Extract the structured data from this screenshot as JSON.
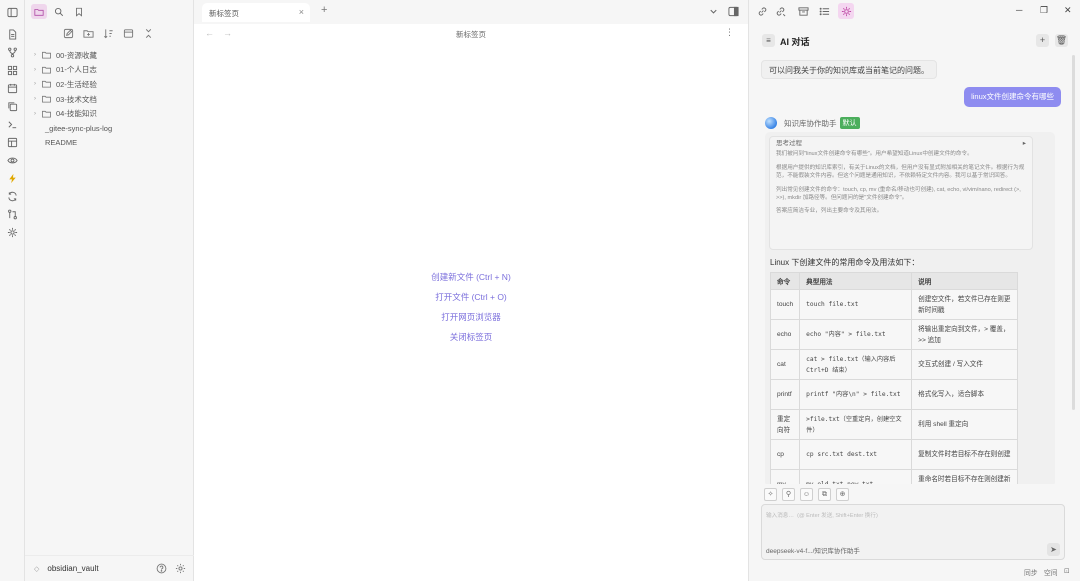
{
  "ribbon": {
    "icons": [
      "files-icon",
      "git-branch-icon",
      "grid-icon",
      "calendar-icon",
      "copy-icon",
      "terminal-icon",
      "layout-icon",
      "eye-icon",
      "lightning-icon",
      "sync-icon",
      "git-compare-icon",
      "settings-burst-icon"
    ]
  },
  "left_panel": {
    "tree": [
      {
        "type": "folder",
        "name": "00-资源收藏"
      },
      {
        "type": "folder",
        "name": "01-个人日志"
      },
      {
        "type": "folder",
        "name": "02-生活经验"
      },
      {
        "type": "folder",
        "name": "03-技术文档"
      },
      {
        "type": "folder",
        "name": "04-技能知识"
      },
      {
        "type": "file",
        "name": "_gitee-sync-plus-log"
      },
      {
        "type": "file",
        "name": "README"
      }
    ],
    "vault": {
      "switch": "◇",
      "name": "obsidian_vault"
    }
  },
  "center": {
    "tab": {
      "label": "新标签页",
      "close": "×"
    },
    "new_tab": "+",
    "view_title": "新标签页",
    "back": "←",
    "forward": "→",
    "more": "⋮",
    "actions": [
      "创建新文件 (Ctrl + N)",
      "打开文件 (Ctrl + O)",
      "打开网页浏览器",
      "关闭标签页"
    ]
  },
  "window": {
    "minimize": "─",
    "maximize": "❐",
    "close": "✕"
  },
  "right_panel": {
    "header": {
      "icon": "≡",
      "title": "AI 对话",
      "new": "+",
      "delete": "🗑"
    },
    "system_message": "可以问我关于你的知识库或当前笔记的问题。",
    "user_message": "linux文件创建命令有哪些",
    "assistant": {
      "name": "知识库协作助手",
      "badge": "默认"
    },
    "thinking": {
      "title": "思考过程",
      "toggle": "▸",
      "paragraphs": [
        "我们被问到\"linux文件创建命令有哪些\"。用户希望知道Linux中创建文件的命令。",
        "根据用户提供的知识库索引，有关于Linux的文档，但用户没有显式附加相关的笔记文件。根据行为规范，不能假装文件内容。但这个问题是通用知识，不依赖特定文件内容。我可以基于常识回答。",
        "列出常见创建文件的命令：touch, cp, mv (重命名/移动也可创建), cat, echo, vi/vim/nano, redirect (>, >>), mkdir 加路径等。但问题问的是\"文件创建命令\"。",
        "答案应简洁专业，列出主要命令及其用法。"
      ]
    },
    "intro": "Linux 下创建文件的常用命令及用法如下：",
    "table": {
      "headers": [
        "命令",
        "典型用法",
        "说明"
      ],
      "rows": [
        [
          "touch",
          "touch file.txt",
          "创建空文件，若文件已存在则更新时间戳"
        ],
        [
          "echo",
          "echo \"内容\" > file.txt",
          "将输出重定向到文件，> 覆盖，>> 追加"
        ],
        [
          "cat",
          "cat > file.txt（输入内容后 Ctrl+D 结束）",
          "交互式创建 / 写入文件"
        ],
        [
          "printf",
          "printf \"内容\\n\" > file.txt",
          "格式化写入，适合脚本"
        ],
        [
          "重定向符",
          ">file.txt（空重定向，创建空文件）",
          "利用 shell 重定向"
        ],
        [
          "cp",
          "cp src.txt dest.txt",
          "复制文件时若目标不存在则创建"
        ],
        [
          "mv",
          "mv old.txt new.txt",
          "重命名时若目标不存在则创建新文件（实质是移动）"
        ]
      ]
    },
    "composer": {
      "tools": [
        "✧",
        "⚲",
        "☺",
        "⧉",
        "⊕"
      ],
      "placeholder": "输入消息…  (@ Enter 发送, Shift+Enter 换行)",
      "model": "deepseek-v4-f.../知识库协作助手",
      "send": "➤"
    },
    "status": {
      "sync": "同步",
      "space": "空间"
    }
  }
}
